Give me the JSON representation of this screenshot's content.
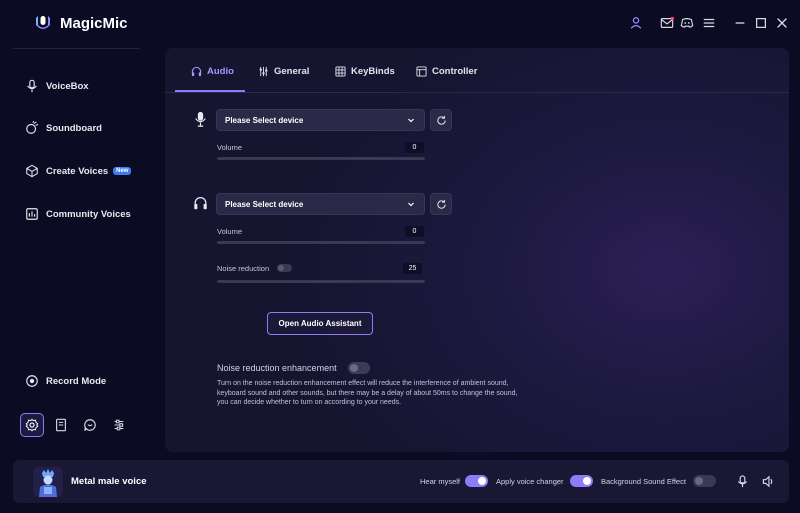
{
  "app": {
    "title": "MagicMic",
    "accent_color": "#8f7cfb"
  },
  "titlebar_icons": [
    "user-icon",
    "mail-icon",
    "discord-icon",
    "menu-icon",
    "minimize-icon",
    "maximize-icon",
    "close-icon"
  ],
  "sidebar": {
    "items": [
      {
        "label": "VoiceBox",
        "icon": "microphone-icon"
      },
      {
        "label": "Soundboard",
        "icon": "soundboard-icon"
      },
      {
        "label": "Create Voices",
        "icon": "cube-icon",
        "badge": "New"
      },
      {
        "label": "Community Voices",
        "icon": "community-icon"
      }
    ],
    "record_mode_label": "Record Mode",
    "bottom_icons": [
      "settings-icon",
      "book-icon",
      "chat-icon",
      "sliders-icon"
    ]
  },
  "tabs": [
    {
      "label": "Audio",
      "icon": "headphones-icon",
      "active": true
    },
    {
      "label": "General",
      "icon": "sliders-icon",
      "active": false
    },
    {
      "label": "KeyBinds",
      "icon": "keyboard-icon",
      "active": false
    },
    {
      "label": "Controller",
      "icon": "controller-icon",
      "active": false
    }
  ],
  "input_device": {
    "select_value": "Please Select device",
    "volume_label": "Volume",
    "volume_value": "0"
  },
  "output_device": {
    "select_value": "Please Select device",
    "volume_label": "Volume",
    "volume_value": "0",
    "noise_label": "Noise reduction",
    "noise_value": "25"
  },
  "assistant_button": "Open Audio Assistant",
  "noise_enhancement": {
    "title": "Noise reduction enhancement",
    "enabled": false,
    "description": "Turn on the noise reduction enhancement effect will reduce the interference of ambient sound, keyboard sound and other sounds, but there may be a delay of about 50ms to change the sound, you can decide whether to turn on according to your needs."
  },
  "bottom_bar": {
    "voice_name": "Metal male voice",
    "hear_myself_label": "Hear myself",
    "hear_myself_on": true,
    "apply_changer_label": "Apply voice changer",
    "apply_changer_on": true,
    "background_effect_label": "Background Sound Effect",
    "background_effect_on": false
  }
}
